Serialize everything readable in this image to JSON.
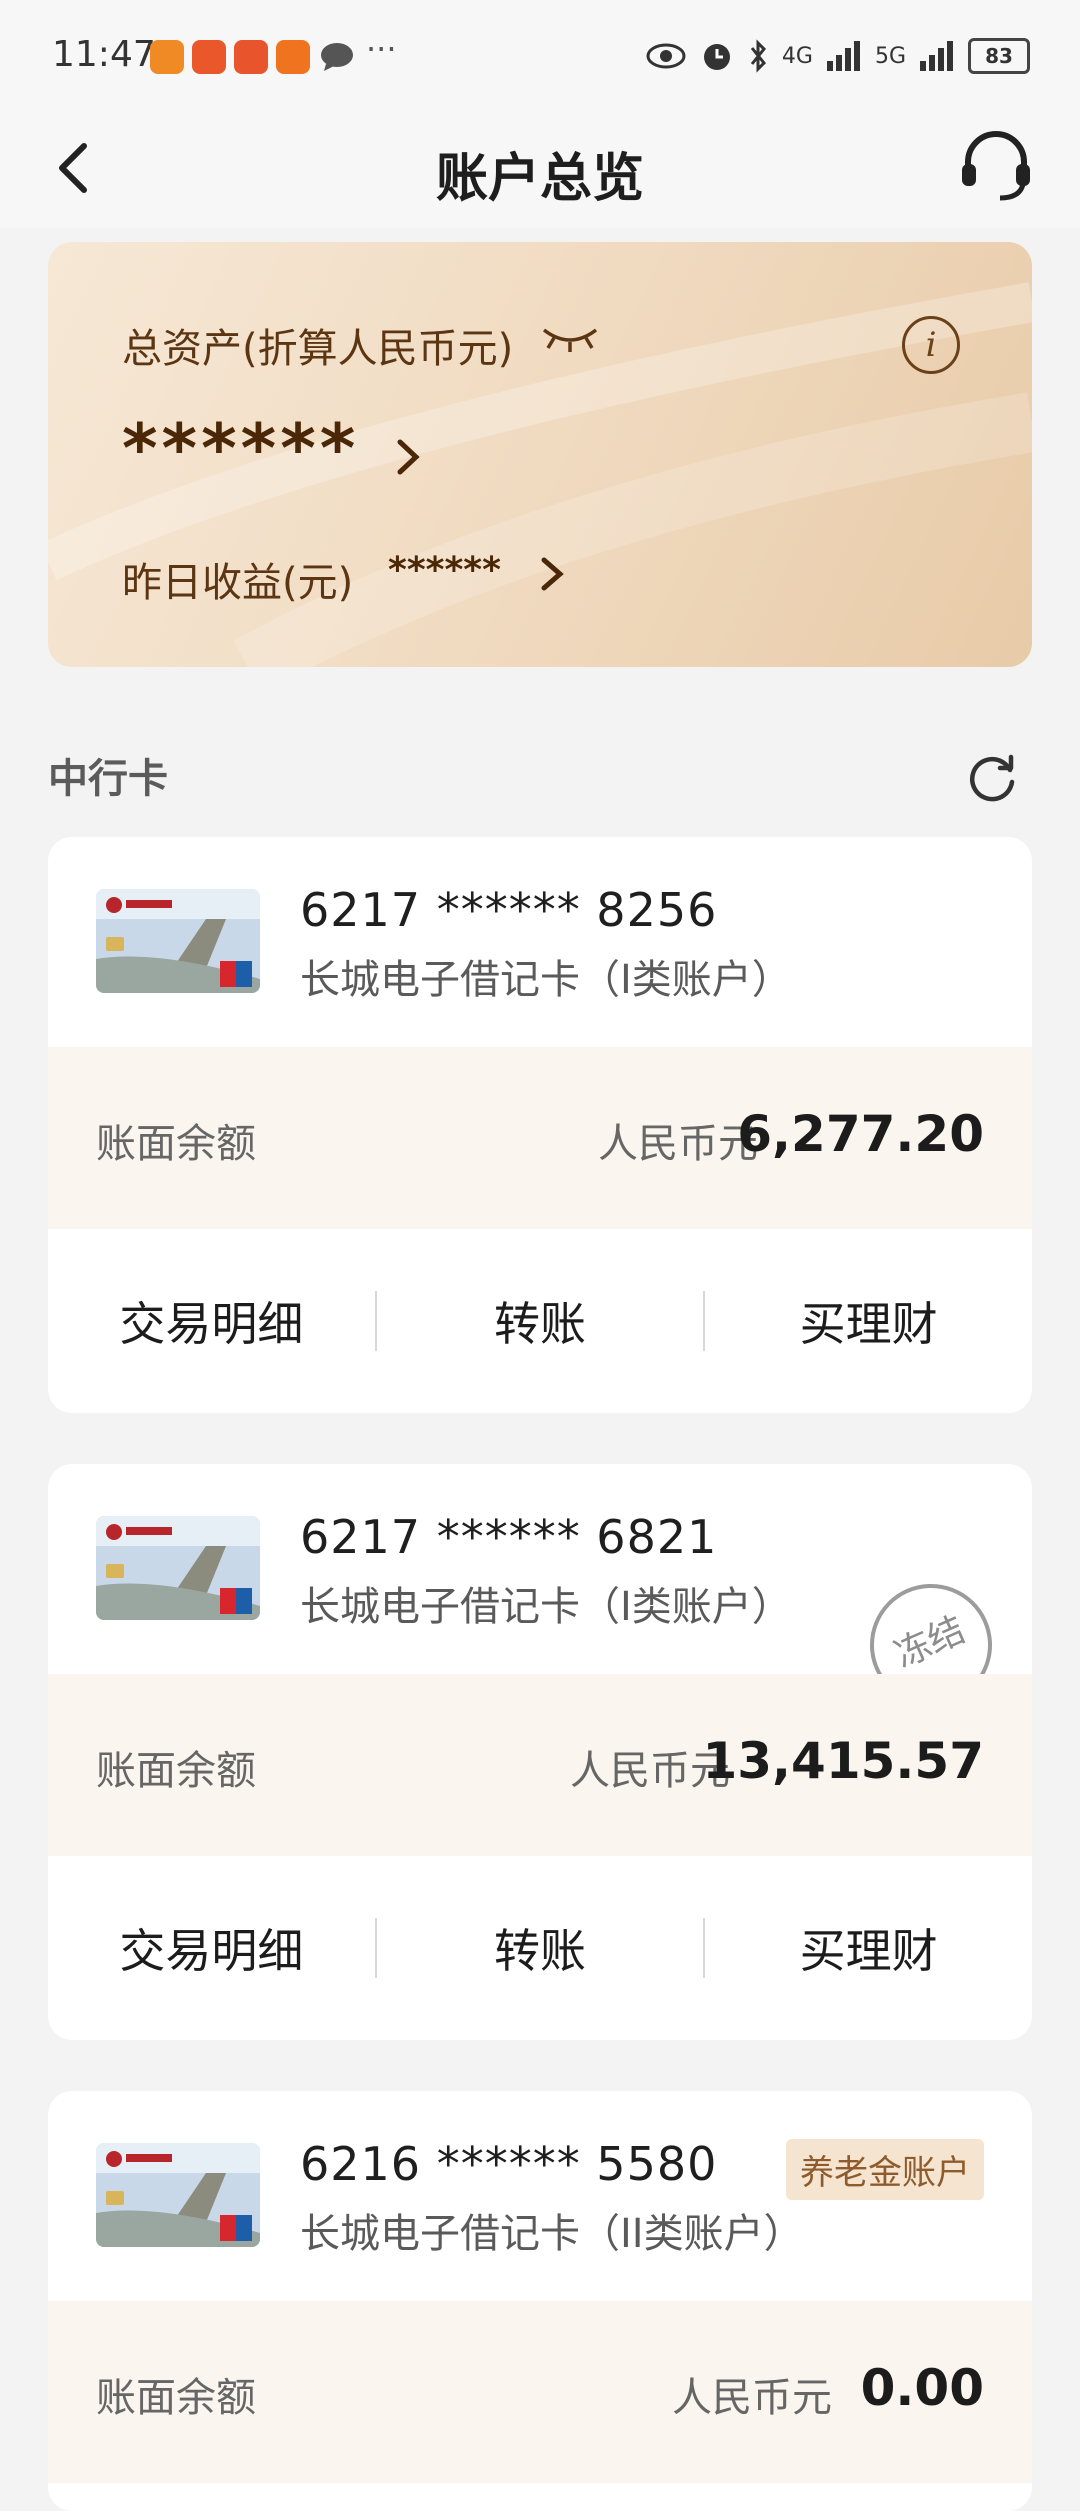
{
  "status_bar": {
    "time": "11:47",
    "battery": "83",
    "net1": "4G",
    "net2": "5G"
  },
  "header": {
    "title": "账户总览"
  },
  "assets": {
    "total_label": "总资产(折算人民币元)",
    "total_value": "******",
    "yesterday_label": "昨日收益(元)",
    "yesterday_value": "******",
    "info_symbol": "i"
  },
  "section": {
    "title": "中行卡"
  },
  "cards": [
    {
      "number": "6217 ****** 8256",
      "type": "长城电子借记卡（I类账户）",
      "balance_label": "账面余额",
      "currency": "人民币元",
      "amount": "6,277.20",
      "actions": [
        "交易明细",
        "转账",
        "买理财"
      ]
    },
    {
      "number": "6217 ****** 6821",
      "type": "长城电子借记卡（I类账户）",
      "stamp": "冻结",
      "balance_label": "账面余额",
      "currency": "人民币元",
      "amount": "13,415.57",
      "actions": [
        "交易明细",
        "转账",
        "买理财"
      ]
    },
    {
      "number": "6216 ****** 5580",
      "type": "长城电子借记卡（II类账户）",
      "badge": "养老金账户",
      "balance_label": "账面余额",
      "currency": "人民币元",
      "amount": "0.00"
    }
  ]
}
